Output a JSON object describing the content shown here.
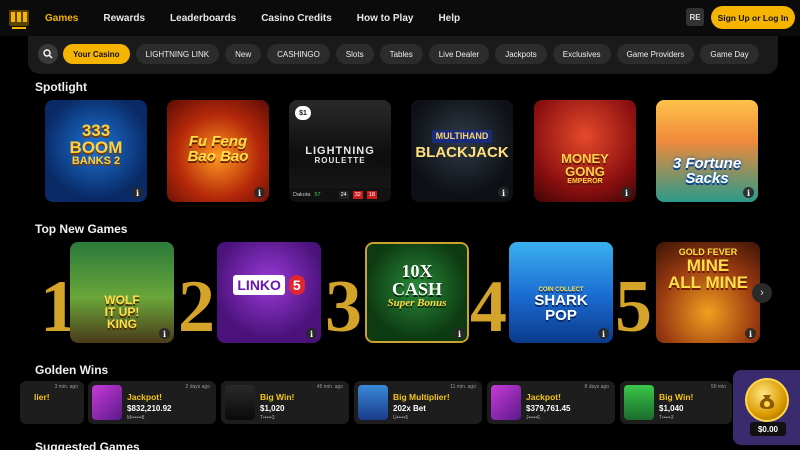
{
  "nav": {
    "links": [
      "Games",
      "Rewards",
      "Leaderboards",
      "Casino Credits",
      "How to Play",
      "Help"
    ],
    "avatar_text": "RE",
    "signup_label": "Sign Up or Log In"
  },
  "filters": [
    "Your Casino",
    "LIGHTNING LINK",
    "New",
    "CASHINGO",
    "Slots",
    "Tables",
    "Live Dealer",
    "Jackpots",
    "Exclusives",
    "Game Providers",
    "Game Day"
  ],
  "spotlight": {
    "title": "Spotlight",
    "games": [
      {
        "name": "333 Boom Banks 2",
        "t1": "333",
        "t2": "BOOM",
        "t3": "BANKS 2"
      },
      {
        "name": "Fu Feng Bao Bao",
        "t1": "Fu Feng",
        "t2": "Bao Bao"
      },
      {
        "name": "Lightning Roulette",
        "t1": "LIGHTNING",
        "t2": "ROULETTE",
        "badge": "$1",
        "dealer": "Dakota",
        "count": "57",
        "nums": [
          "24",
          "32",
          "18"
        ]
      },
      {
        "name": "Multihand Blackjack",
        "t1": "MULTIHAND",
        "t2": "BLACKJACK"
      },
      {
        "name": "Money Gong Emperor",
        "t1": "MONEY",
        "t2": "GONG",
        "t3": "EMPEROR"
      },
      {
        "name": "3 Fortune Sacks",
        "t1": "3 Fortune",
        "t2": "Sacks"
      }
    ]
  },
  "top_new": {
    "title": "Top New Games",
    "games": [
      {
        "rank": "1",
        "t1": "WOLF",
        "t2": "IT UP!",
        "t3": "KING"
      },
      {
        "rank": "2",
        "t1": "LINKO",
        "t2": "5"
      },
      {
        "rank": "3",
        "t1": "10X",
        "t2": "CASH",
        "t3": "Super Bonus"
      },
      {
        "rank": "4",
        "t1": "COIN COLLECT",
        "t2": "SHARK",
        "t3": "POP"
      },
      {
        "rank": "5",
        "t1": "GOLD FEVER",
        "t2": "MINE",
        "t3": "ALL MINE"
      }
    ]
  },
  "golden_wins": {
    "title": "Golden Wins",
    "items": [
      {
        "title": "lier!",
        "amount": "",
        "time": "3 min. ago"
      },
      {
        "title": "Jackpot!",
        "amount": "$832,210.92",
        "user": "M••••••8",
        "time": "2 days ago"
      },
      {
        "title": "Big Win!",
        "amount": "$1,020",
        "user": "T•••••3",
        "time": "46 min. ago"
      },
      {
        "title": "Big Multiplier!",
        "amount": "202x Bet",
        "user": "U•••••5",
        "time": "11 min. ago"
      },
      {
        "title": "Jackpot!",
        "amount": "$379,761.45",
        "user": "J•••••6",
        "time": "8 days ago"
      },
      {
        "title": "Big Win!",
        "amount": "$1,040",
        "user": "T•••••3",
        "time": "50 min"
      }
    ]
  },
  "wallet": {
    "amount": "$0.00"
  },
  "suggested": {
    "title": "Suggested Games"
  },
  "info_glyph": "i",
  "arrow_glyph": "›"
}
